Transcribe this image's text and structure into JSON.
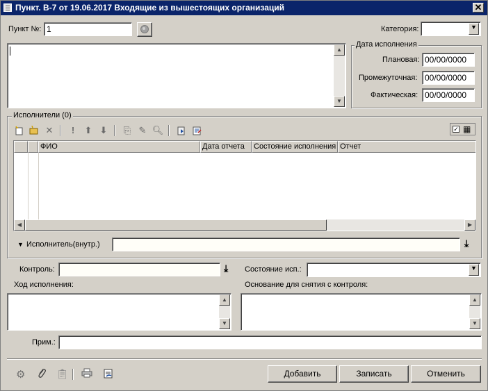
{
  "window": {
    "title": "Пункт. В-7 от 19.06.2017 Входящие из вышестоящих организаций",
    "close_glyph": "✕"
  },
  "item": {
    "label": "Пункт №:",
    "value": "1"
  },
  "category": {
    "label": "Категория:",
    "value": ""
  },
  "dates": {
    "group_title": "Дата исполнения",
    "planned_label": "Плановая:",
    "planned_value": "00/00/0000",
    "intermediate_label": "Промежуточная:",
    "intermediate_value": "00/00/0000",
    "actual_label": "Фактическая:",
    "actual_value": "00/00/0000"
  },
  "executors": {
    "group_title": "Исполнители (0)",
    "columns": [
      "",
      "",
      "ФИО",
      "Дата отчета",
      "Состояние исполнения",
      "Отчет"
    ],
    "rows": [],
    "internal_label": "Исполнитель(внутр.)",
    "internal_value": ""
  },
  "control": {
    "label": "Контроль:",
    "value": ""
  },
  "state": {
    "label": "Состояние исп.:",
    "value": ""
  },
  "progress": {
    "label": "Ход исполнения:",
    "value": ""
  },
  "basis": {
    "label": "Основание для снятия с контроля:",
    "value": ""
  },
  "note": {
    "label": "Прим.:",
    "value": ""
  },
  "buttons": {
    "add": "Добавить",
    "save": "Записать",
    "cancel": "Отменить"
  }
}
